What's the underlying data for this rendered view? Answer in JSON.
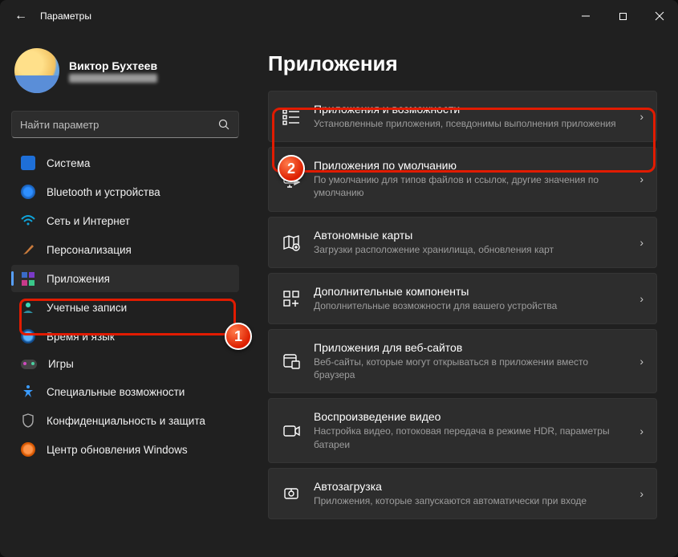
{
  "window": {
    "title": "Параметры"
  },
  "profile": {
    "name": "Виктор Бухтеев"
  },
  "search": {
    "placeholder": "Найти параметр"
  },
  "nav": [
    {
      "label": "Система"
    },
    {
      "label": "Bluetooth и устройства"
    },
    {
      "label": "Сеть и Интернет"
    },
    {
      "label": "Персонализация"
    },
    {
      "label": "Приложения"
    },
    {
      "label": "Учетные записи"
    },
    {
      "label": "Время и язык"
    },
    {
      "label": "Игры"
    },
    {
      "label": "Специальные возможности"
    },
    {
      "label": "Конфиденциальность и защита"
    },
    {
      "label": "Центр обновления Windows"
    }
  ],
  "page": {
    "title": "Приложения"
  },
  "cards": [
    {
      "title": "Приложения и возможности",
      "sub": "Установленные приложения, псевдонимы выполнения приложения"
    },
    {
      "title": "Приложения по умолчанию",
      "sub": "По умолчанию для типов файлов и ссылок, другие значения по умолчанию"
    },
    {
      "title": "Автономные карты",
      "sub": "Загрузки расположение хранилища, обновления карт"
    },
    {
      "title": "Дополнительные компоненты",
      "sub": "Дополнительные возможности для вашего устройства"
    },
    {
      "title": "Приложения для веб-сайтов",
      "sub": "Веб-сайты, которые могут открываться в приложении вместо браузера"
    },
    {
      "title": "Воспроизведение видео",
      "sub": "Настройка видео, потоковая передача в режиме HDR, параметры батареи"
    },
    {
      "title": "Автозагрузка",
      "sub": "Приложения, которые запускаются автоматически при входе"
    }
  ],
  "annotations": {
    "badge1": "1",
    "badge2": "2"
  }
}
